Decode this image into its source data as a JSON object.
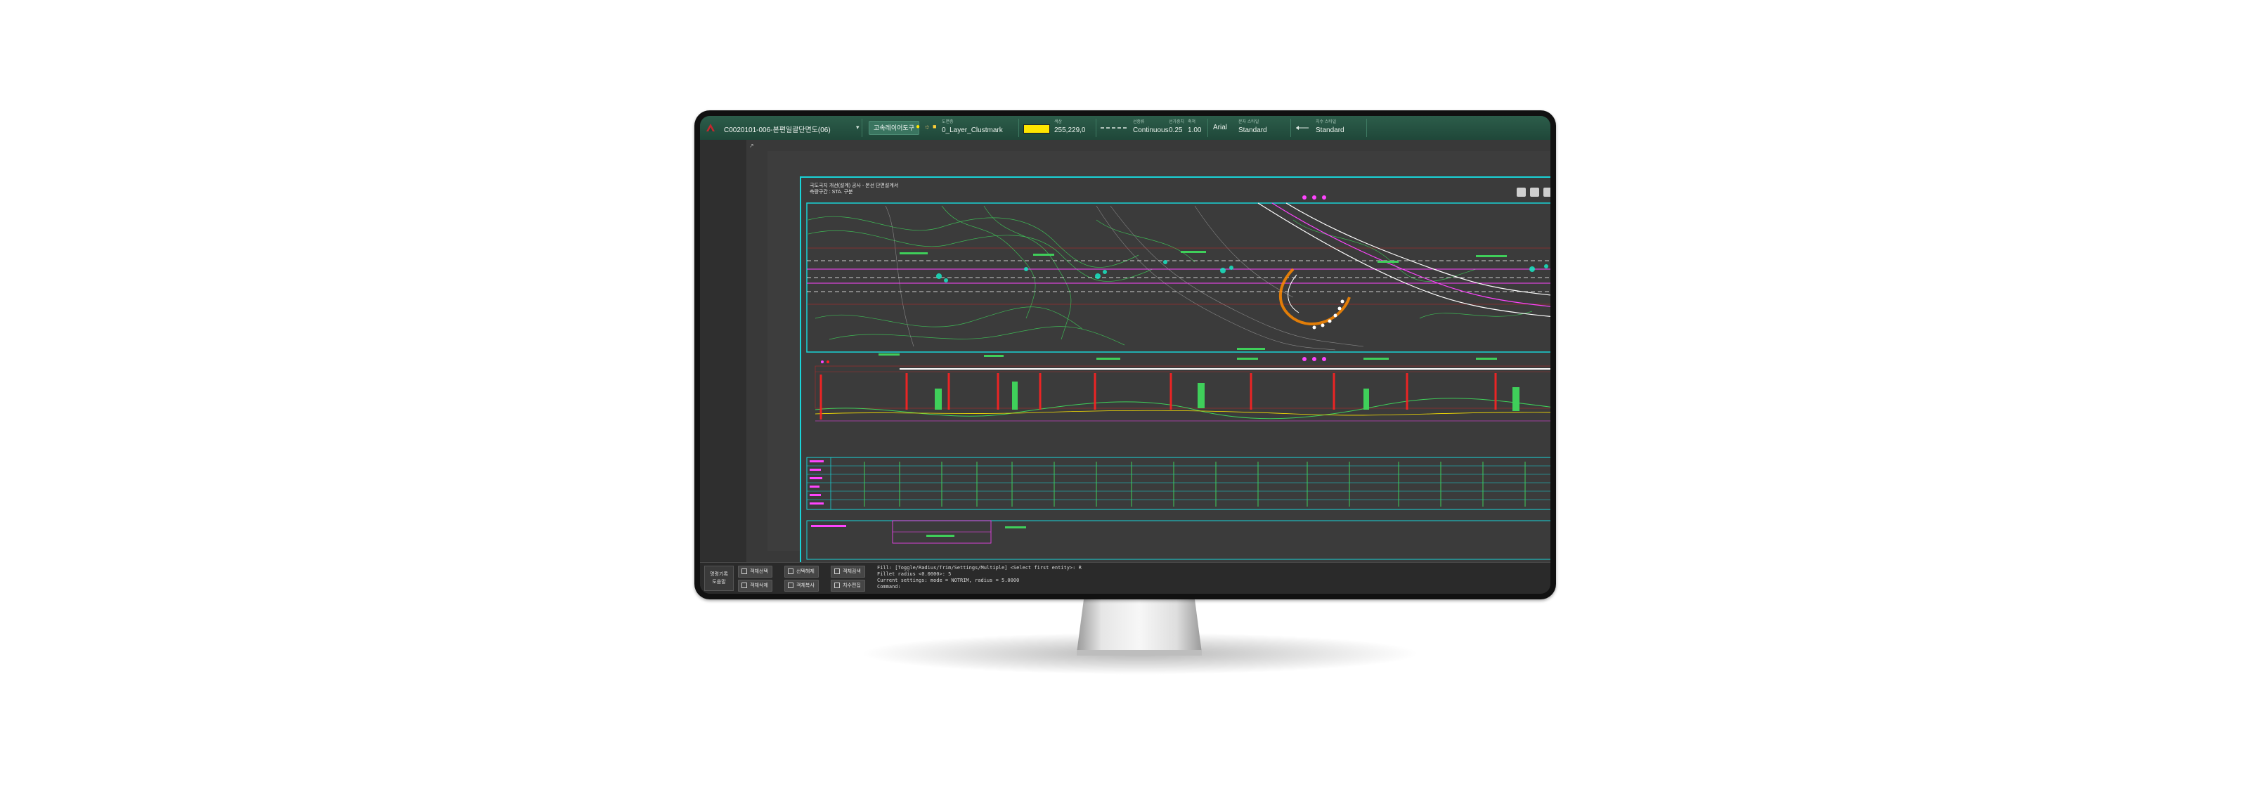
{
  "app": {
    "title": "C0020101-006-본편일괄단면도(06)"
  },
  "toolbar": {
    "layer_manager_label": "고속레이어도구",
    "layer_caption": "도면층",
    "layer_name": "0_Layer_Clustmark",
    "color_caption": "색상",
    "color_value": "255,229,0",
    "color_hex": "#ffe600",
    "linetype_caption": "선종류",
    "linetype_value": "Continuous",
    "lineweight_caption": "선가중치",
    "lineweight_value": "0.25",
    "ltscale_caption": "축척",
    "ltscale_value": "1.00",
    "font_value": "Arial",
    "textstyle_caption": "문자 스타일",
    "textstyle_value": "Standard",
    "dimstyle_caption": "치수 스타일",
    "dimstyle_value": "Standard"
  },
  "drawing": {
    "title_line1": "국도국지 개선(설계) 공사 - 본선 단면설계서",
    "title_line2": "측량구간 : STA. 구분",
    "accent_color": "#19d4d8",
    "road_color": "#ff44ff",
    "contour_color": "#22ff44",
    "section_color": "#ff2222"
  },
  "command": {
    "panel_label_1": "명령기록",
    "panel_label_2": "도움말",
    "buttons": [
      "객체선택",
      "선택해제",
      "객체검색",
      "객체삭제",
      "객체복사",
      "치수편집"
    ],
    "lines": [
      "Fill: [Toggle/Radius/Trim/Settings/Multiple] <Select first entity>: R",
      "Fillet radius <0.0000>: 5",
      "Current settings: mode = NOTRIM, radius = 5.0000",
      "Command:"
    ]
  }
}
